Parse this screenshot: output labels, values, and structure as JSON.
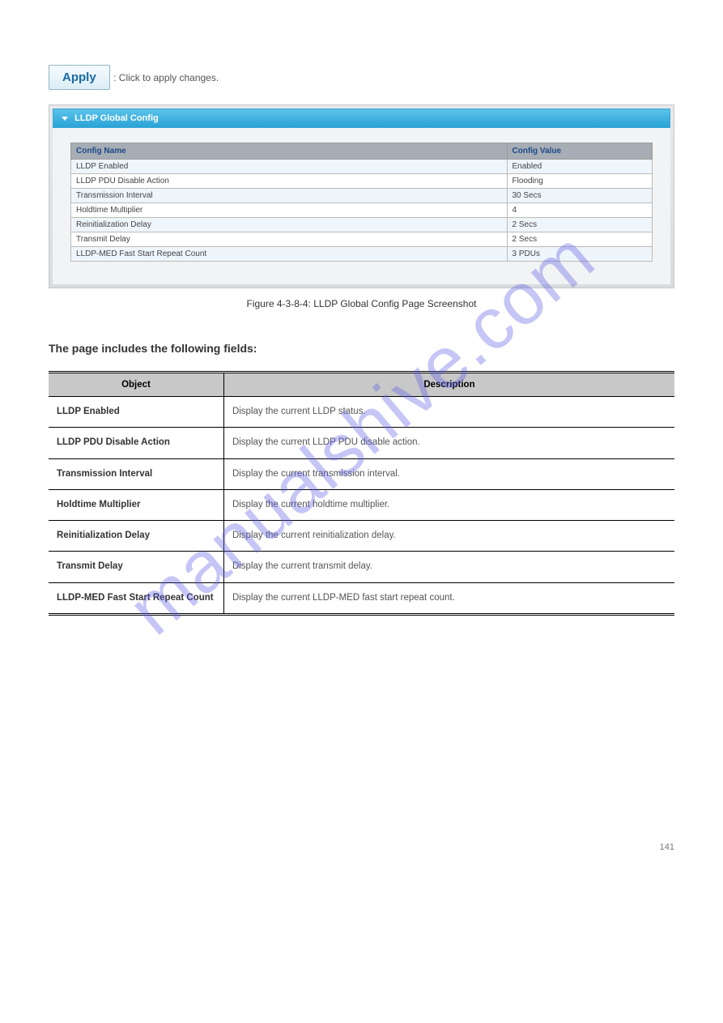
{
  "watermark": "manualshive.com",
  "apply_button": "Apply",
  "top_paragraph": ": Click to apply changes.",
  "panel": {
    "title": "LLDP Global Config",
    "headers": {
      "name": "Config Name",
      "value": "Config Value"
    },
    "rows": [
      {
        "name": "LLDP Enabled",
        "value": "Enabled"
      },
      {
        "name": "LLDP PDU Disable Action",
        "value": "Flooding"
      },
      {
        "name": "Transmission Interval",
        "value": "30 Secs"
      },
      {
        "name": "Holdtime Multiplier",
        "value": "4"
      },
      {
        "name": "Reinitialization Delay",
        "value": "2 Secs"
      },
      {
        "name": "Transmit Delay",
        "value": "2 Secs"
      },
      {
        "name": "LLDP-MED Fast Start Repeat Count",
        "value": "3 PDUs"
      }
    ]
  },
  "figure_caption": "Figure 4-3-8-4: LLDP Global Config Page Screenshot",
  "section_heading": "The page includes the following fields:",
  "obj_table": {
    "headers": {
      "object": "Object",
      "desc": "Description"
    },
    "rows": [
      {
        "object": "LLDP Enabled",
        "desc": "Display the current LLDP status."
      },
      {
        "object": "LLDP PDU Disable Action",
        "desc": "Display the current LLDP PDU disable action."
      },
      {
        "object": "Transmission Interval",
        "desc": "Display the current transmission interval."
      },
      {
        "object": "Holdtime Multiplier",
        "desc": "Display the current holdtime multiplier."
      },
      {
        "object": "Reinitialization Delay",
        "desc": "Display the current reinitialization delay."
      },
      {
        "object": "Transmit Delay",
        "desc": "Display the current transmit delay."
      },
      {
        "object": "LLDP-MED Fast Start Repeat Count",
        "desc": "Display the current LLDP-MED fast start repeat count."
      }
    ]
  },
  "footer": "141"
}
